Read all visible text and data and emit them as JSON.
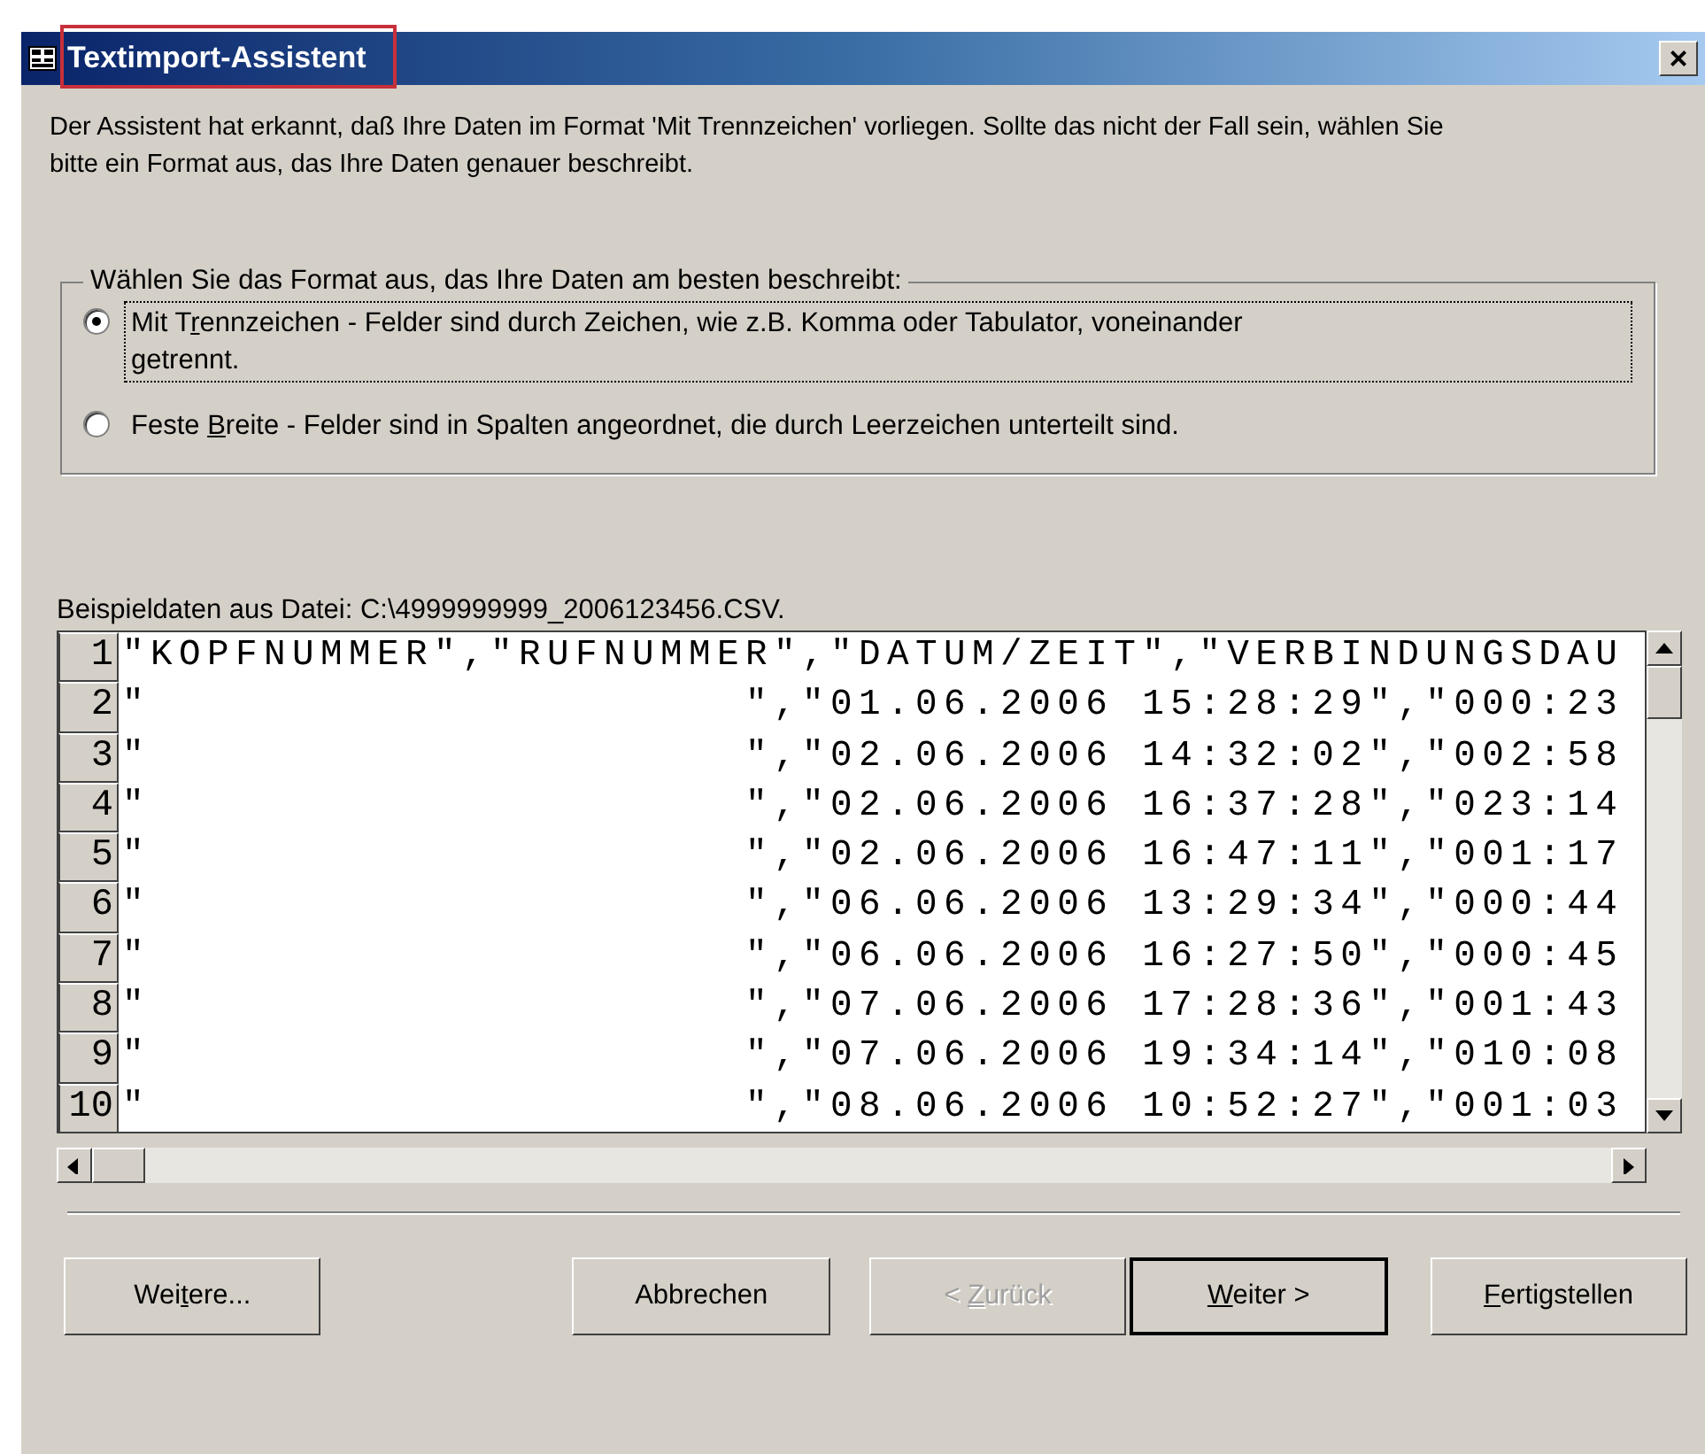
{
  "window": {
    "title": "Textimport-Assistent",
    "close": "×"
  },
  "intro": "Der Assistent hat erkannt, daß Ihre Daten im Format 'Mit Trennzeichen' vorliegen.  Sollte das nicht der Fall sein, wählen Sie bitte ein Format aus, das Ihre Daten genauer beschreibt.",
  "format_group": {
    "legend": "Wählen Sie das Format aus, das Ihre Daten am besten beschreibt:",
    "options": [
      {
        "before": "Mit T",
        "key": "r",
        "after": "ennzeichen - Felder sind durch Zeichen, wie z.B. Komma oder Tabulator, voneinander getrennt.",
        "selected": true
      },
      {
        "before": "Feste ",
        "key": "B",
        "after": "reite - Felder sind in Spalten angeordnet, die durch Leerzeichen unterteilt sind.",
        "selected": false
      }
    ]
  },
  "sample": {
    "label": "Beispieldaten aus Datei: C:\\4999999999_2006123456.CSV.",
    "rows": [
      {
        "number": "1",
        "text": "\"KOPFNUMMER\",\"RUFNUMMER\",\"DATUM/ZEIT\",\"VERBINDUNGSDAU"
      },
      {
        "number": "2",
        "text": "\"                     \",\"01.06.2006 15:28:29\",\"000:23"
      },
      {
        "number": "3",
        "text": "\"                     \",\"02.06.2006 14:32:02\",\"002:58"
      },
      {
        "number": "4",
        "text": "\"                     \",\"02.06.2006 16:37:28\",\"023:14"
      },
      {
        "number": "5",
        "text": "\"                     \",\"02.06.2006 16:47:11\",\"001:17"
      },
      {
        "number": "6",
        "text": "\"                     \",\"06.06.2006 13:29:34\",\"000:44"
      },
      {
        "number": "7",
        "text": "\"                     \",\"06.06.2006 16:27:50\",\"000:45"
      },
      {
        "number": "8",
        "text": "\"                     \",\"07.06.2006 17:28:36\",\"001:43"
      },
      {
        "number": "9",
        "text": "\"                     \",\"07.06.2006 19:34:14\",\"010:08"
      },
      {
        "number": "10",
        "text": "\"                     \",\"08.06.2006 10:52:27\",\"001:03"
      }
    ]
  },
  "buttons": [
    {
      "before": "Wei",
      "key": "t",
      "after": "ere...",
      "disabled": false,
      "default": false
    },
    {
      "before": "Abbrechen",
      "disabled": false,
      "default": false
    },
    {
      "before": "< ",
      "key": "Z",
      "after": "urück",
      "disabled": true,
      "default": false
    },
    {
      "key": "W",
      "after": "eiter >",
      "disabled": false,
      "default": true
    },
    {
      "key": "F",
      "after": "ertigstellen",
      "disabled": false,
      "default": false
    }
  ]
}
